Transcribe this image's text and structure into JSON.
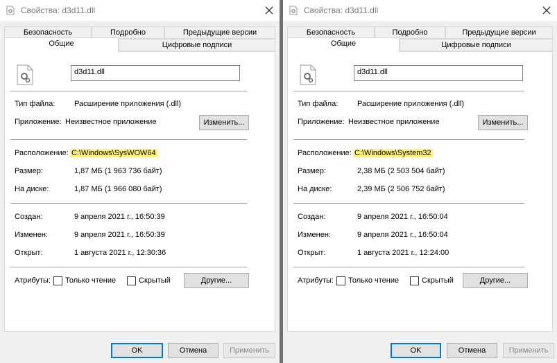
{
  "windows": [
    {
      "title": "Свойства: d3d11.dll",
      "tabs": [
        "Безопасность",
        "Подробно",
        "Предыдущие версии",
        "Общие",
        "Цифровые подписи"
      ],
      "filename": "d3d11.dll",
      "type_label": "Тип файла:",
      "type_value": "Расширение приложения (.dll)",
      "app_label": "Приложение:",
      "app_value": "Неизвестное приложение",
      "change_button": "Изменить...",
      "location_label": "Расположение:",
      "location_value": "C:\\Windows\\SysWOW64",
      "size_label": "Размер:",
      "size_value": "1,87 МБ (1 963 736 байт)",
      "disk_label": "На диске:",
      "disk_value": "1,87 МБ (1 966 080 байт)",
      "created_label": "Создан:",
      "created_value": "9 апреля 2021 г., 16:50:39",
      "modified_label": "Изменен:",
      "modified_value": "9 апреля 2021 г., 16:50:39",
      "opened_label": "Открыт:",
      "opened_value": "1 августа 2021 г., 12:30:36",
      "attributes_label": "Атрибуты:",
      "readonly_label": "Только чтение",
      "hidden_label": "Скрытый",
      "other_button": "Другие...",
      "ok_button": "OK",
      "cancel_button": "Отмена",
      "apply_button": "Применить"
    },
    {
      "title": "Свойства: d3d11.dll",
      "tabs": [
        "Безопасность",
        "Подробно",
        "Предыдущие версии",
        "Общие",
        "Цифровые подписи"
      ],
      "filename": "d3d11.dll",
      "type_label": "Тип файла:",
      "type_value": "Расширение приложения (.dll)",
      "app_label": "Приложение:",
      "app_value": "Неизвестное приложение",
      "change_button": "Изменить...",
      "location_label": "Расположение:",
      "location_value": "C:\\Windows\\System32",
      "size_label": "Размер:",
      "size_value": "2,38 МБ (2 503 504 байт)",
      "disk_label": "На диске:",
      "disk_value": "2,39 МБ (2 506 752 байт)",
      "created_label": "Создан:",
      "created_value": "9 апреля 2021 г., 16:50:04",
      "modified_label": "Изменен:",
      "modified_value": "9 апреля 2021 г., 16:50:04",
      "opened_label": "Открыт:",
      "opened_value": "1 августа 2021 г., 12:24:00",
      "attributes_label": "Атрибуты:",
      "readonly_label": "Только чтение",
      "hidden_label": "Скрытый",
      "other_button": "Другие...",
      "ok_button": "OK",
      "cancel_button": "Отмена",
      "apply_button": "Применить"
    }
  ],
  "colors": {
    "highlight": "#fff27a",
    "dialog_bg": "#f0f0f0",
    "accent": "#0078d7"
  },
  "icons": {
    "title": "file-gear-icon",
    "close": "close-icon",
    "file": "dll-file-icon"
  }
}
